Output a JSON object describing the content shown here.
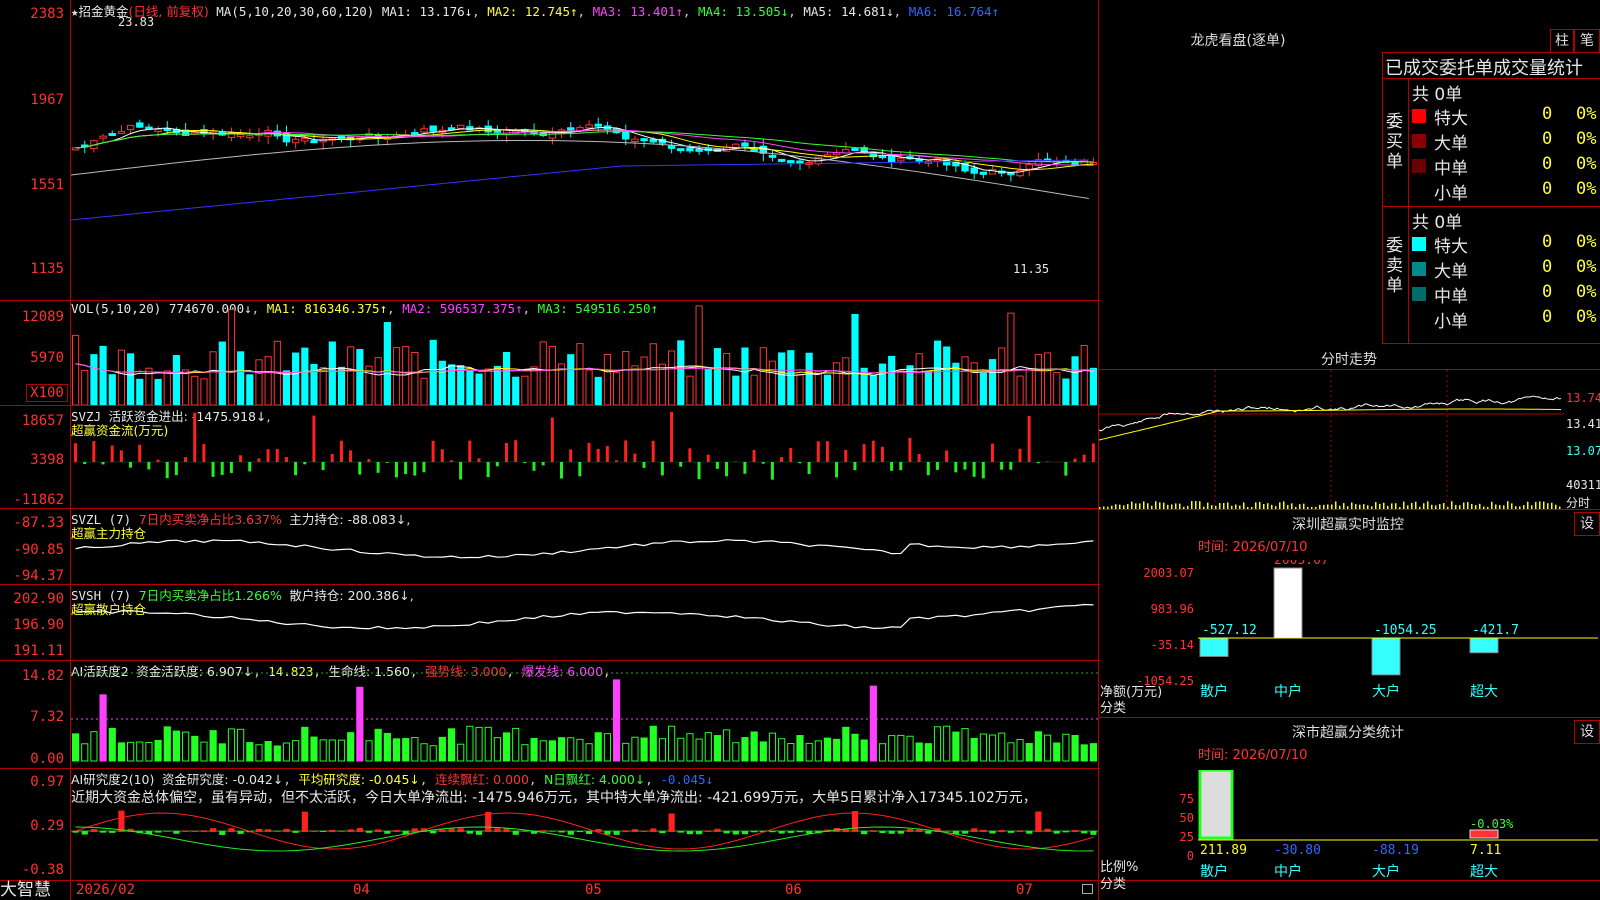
{
  "app": {
    "brand": "大智慧"
  },
  "colors": {
    "up": "#ff3333",
    "down": "#00ffff",
    "grid": "#b00000",
    "ma1": "#ffffff",
    "ma2": "#ffff00",
    "ma3": "#ff40ff",
    "ma4": "#33ff33",
    "ma5": "#bbbbbb",
    "ma6": "#3333ff"
  },
  "main": {
    "header": {
      "star": "★",
      "name": "招金黄金",
      "mode": "(日线, 前复权)",
      "ma_label": "MA(5,10,20,30,60,120)",
      "ma1": "MA1: 13.176↓",
      "ma2": "MA2: 12.745↑",
      "ma3": "MA3: 13.401↑",
      "ma4": "MA4: 13.505↓",
      "ma5": "MA5: 14.681↓",
      "ma6": "MA6: 16.764↑"
    },
    "y_labels": [
      "2383",
      "1967",
      "1551",
      "1135"
    ],
    "high_label": "23.83",
    "low_label": "11.35"
  },
  "vol": {
    "header": {
      "name": "VOL(5,10,20)",
      "value": "774670.000↓",
      "ma1": "MA1: 816346.375↑",
      "ma2": "MA2: 596537.375↑",
      "ma3": "MA3: 549516.250↑"
    },
    "y_labels": [
      "12089",
      "5970"
    ],
    "unit": "X100"
  },
  "svzj": {
    "header": {
      "name": "SVZJ",
      "line1": "活跃资金进出: -1475.918↓,",
      "line2": "超赢资金流(万元)"
    },
    "y_labels": [
      "18657",
      "3398",
      "-11862"
    ]
  },
  "svzl": {
    "header": {
      "name": "SVZL (7)",
      "t1": "7日内买卖净占比3.637%",
      "t2": "主力持仓: -88.083↓,",
      "line2": "超赢主力持仓"
    },
    "y_labels": [
      "-87.33",
      "-90.85",
      "-94.37"
    ]
  },
  "svsh": {
    "header": {
      "name": "SVSH (7)",
      "t1": "7日内买卖净占比1.266%",
      "t2": "散户持仓: 200.386↓,",
      "line2": "超赢散户持仓"
    },
    "y_labels": [
      "202.90",
      "196.90",
      "191.11"
    ]
  },
  "ai1": {
    "header": {
      "name": "AI活跃度2",
      "t1": "资金活跃度: 6.907↓",
      "t2": "14.823",
      "t3": "生命线: 1.560",
      "t4": "强势线: 3.000",
      "t5": "爆发线: 6.000"
    },
    "y_labels": [
      "14.82",
      "7.32",
      "0.00"
    ]
  },
  "ai2": {
    "header": {
      "name": "AI研究度2(10)",
      "t1": "资金研究度: -0.042↓",
      "t2": "平均研究度: -0.045↓",
      "t3": "连续飘红: 0.000",
      "t4": "N日飘红: 4.000↓",
      "t5": "-0.045↓",
      "comment": "近期大资金总体偏空，虽有异动，但不太活跃，今日大单净流出: -1475.946万元，其中特大单净流出: -421.699万元，大单5日累计净入17345.102万元，"
    },
    "y_labels": [
      "0.97",
      "0.29",
      "-0.38"
    ]
  },
  "xaxis": {
    "labels": [
      "2026/02",
      "04",
      "05",
      "06",
      "07"
    ]
  },
  "right": {
    "lh": {
      "title": "龙虎看盘(逐单)",
      "tab_bar": "柱",
      "tab_tick": "笔",
      "header": "已成交委托单成交量统计",
      "buy": {
        "side_label": "委买单",
        "total": "共 0单",
        "rows": [
          {
            "label": "特大",
            "val": "0",
            "pct": "0%",
            "color": "#ff0000"
          },
          {
            "label": "大单",
            "val": "0",
            "pct": "0%",
            "color": "#8b0000"
          },
          {
            "label": "中单",
            "val": "0",
            "pct": "0%",
            "color": "#6a0000"
          },
          {
            "label": "小单",
            "val": "0",
            "pct": "0%",
            "color": "#000000"
          }
        ]
      },
      "sell": {
        "side_label": "委卖单",
        "total": "共 0单",
        "rows": [
          {
            "label": "特大",
            "val": "0",
            "pct": "0%",
            "color": "#00ffff"
          },
          {
            "label": "大单",
            "val": "0",
            "pct": "0%",
            "color": "#008b8b"
          },
          {
            "label": "中单",
            "val": "0",
            "pct": "0%",
            "color": "#006b6b"
          },
          {
            "label": "小单",
            "val": "0",
            "pct": "0%",
            "color": "#000000"
          }
        ]
      }
    },
    "fs": {
      "title": "分时走势",
      "y_labels": [
        "13.74",
        "13.41",
        "13.07"
      ],
      "vol_label": "40311",
      "vol_unit": "分时"
    },
    "sz": {
      "title": "深圳超赢实时监控",
      "set": "设",
      "time": "时间: 2026/07/10",
      "y_labels": [
        "2003.07",
        "983.96",
        "-35.14",
        "-1054.25"
      ],
      "ylabel": "净额(万元)",
      "cat_label": "分类",
      "cats": [
        "散户",
        "中户",
        "大户",
        "超大"
      ],
      "values": [
        "-527.12",
        "2003.07",
        "-1054.25",
        "-421.7"
      ]
    },
    "sc": {
      "title": "深市超赢分类统计",
      "set": "设",
      "time": "时间: 2026/07/10",
      "y_labels": [
        "75",
        "50",
        "25",
        "0"
      ],
      "ylabel": "比例%",
      "cat_label": "分类",
      "cats": [
        "散户",
        "中户",
        "大户",
        "超大"
      ],
      "values": [
        "211.89",
        "-30.80",
        "-88.19",
        "7.11"
      ],
      "pct_note": "-0.03%"
    }
  }
}
